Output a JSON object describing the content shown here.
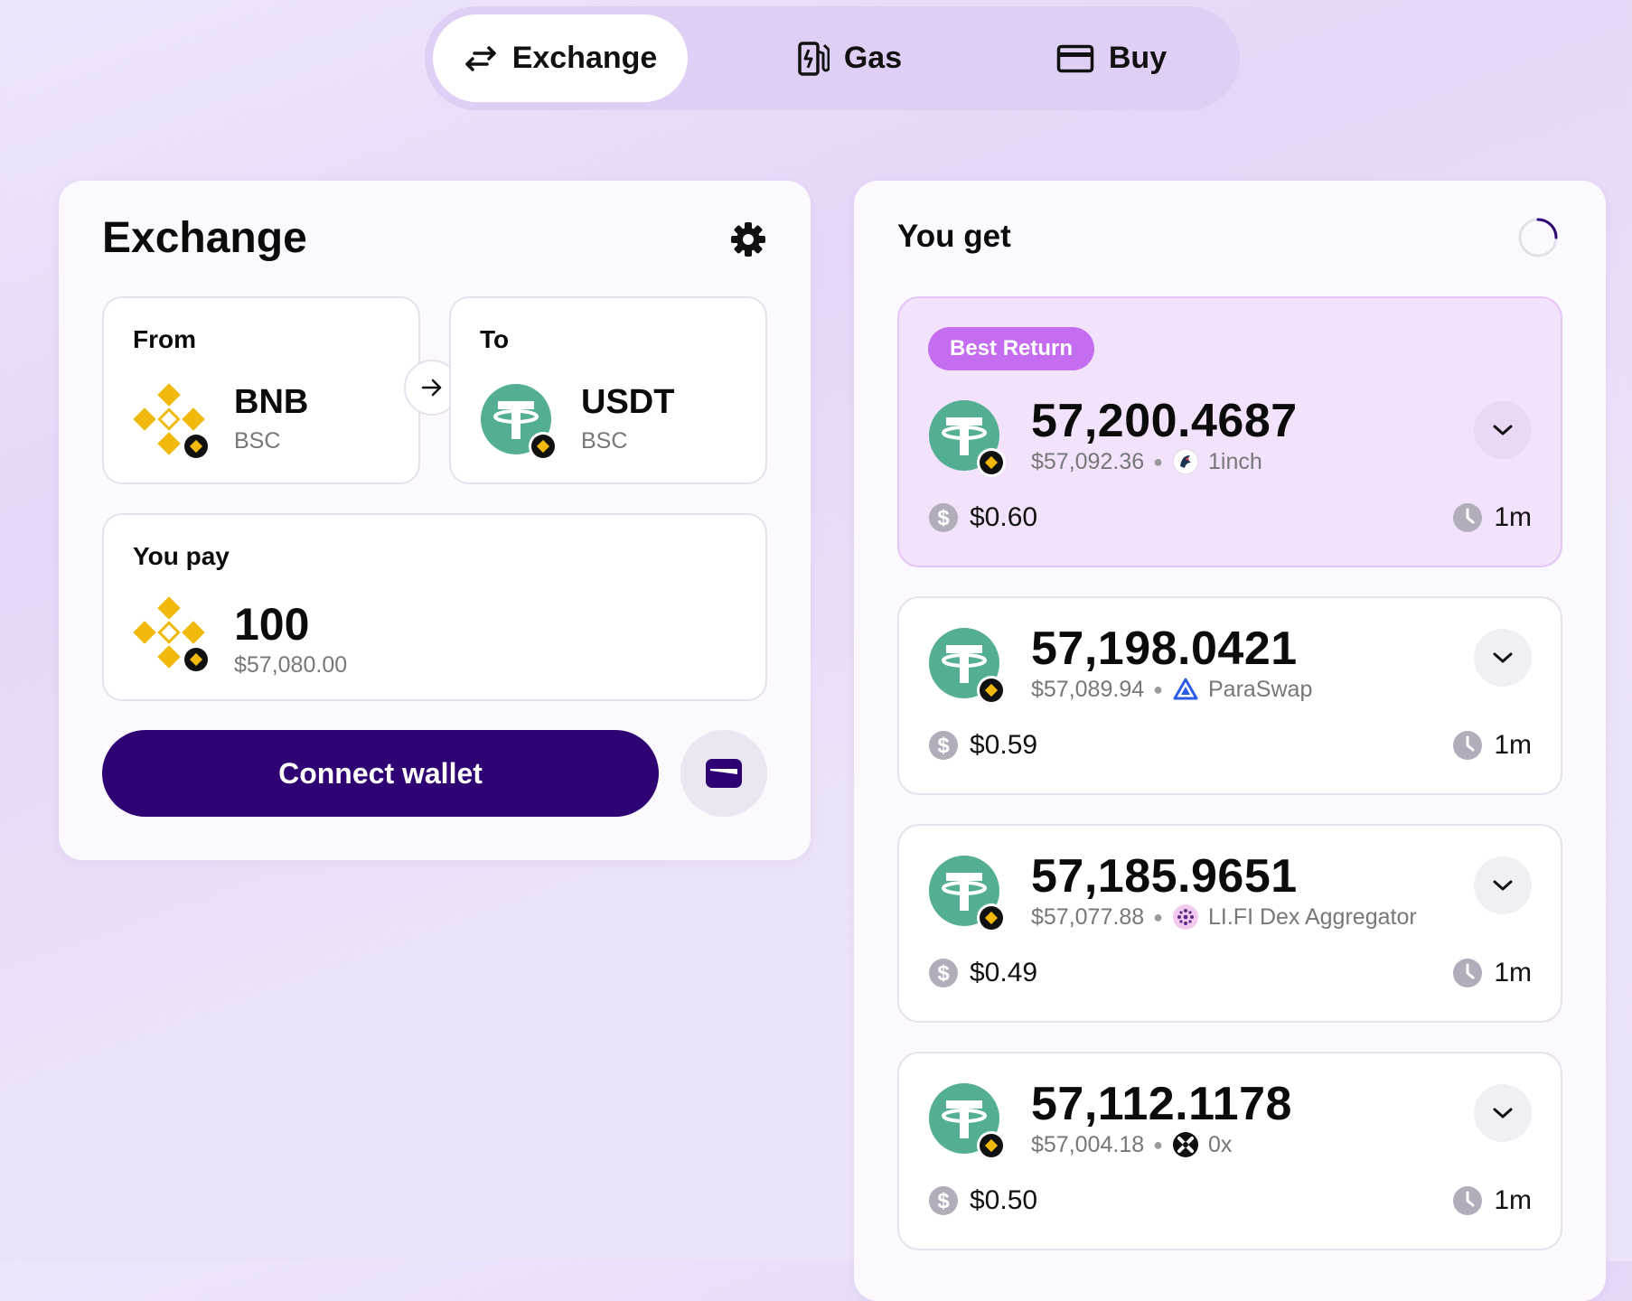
{
  "nav": {
    "tabs": [
      {
        "label": "Exchange",
        "icon": "swap-arrows-icon",
        "active": true
      },
      {
        "label": "Gas",
        "icon": "gas-pump-icon",
        "active": false
      },
      {
        "label": "Buy",
        "icon": "credit-card-icon",
        "active": false
      }
    ]
  },
  "exchange": {
    "title": "Exchange",
    "from": {
      "label": "From",
      "symbol": "BNB",
      "network": "BSC"
    },
    "to": {
      "label": "To",
      "symbol": "USDT",
      "network": "BSC"
    },
    "pay": {
      "label": "You pay",
      "amount": "100",
      "usd": "$57,080.00"
    },
    "connect_label": "Connect wallet"
  },
  "results": {
    "title": "You get",
    "best_label": "Best Return",
    "quotes": [
      {
        "amount": "57,200.4687",
        "usd": "$57,092.36",
        "provider": "1inch",
        "fee": "$0.60",
        "time": "1m"
      },
      {
        "amount": "57,198.0421",
        "usd": "$57,089.94",
        "provider": "ParaSwap",
        "fee": "$0.59",
        "time": "1m"
      },
      {
        "amount": "57,185.9651",
        "usd": "$57,077.88",
        "provider": "LI.FI Dex Aggregator",
        "fee": "$0.49",
        "time": "1m"
      },
      {
        "amount": "57,112.1178",
        "usd": "$57,004.18",
        "provider": "0x",
        "fee": "$0.50",
        "time": "1m"
      }
    ]
  },
  "colors": {
    "primary": "#2e0273",
    "badge": "#c46df0",
    "best_bg": "#f3e2fb",
    "usdt": "#53ae94",
    "bnb": "#f0b90b"
  }
}
